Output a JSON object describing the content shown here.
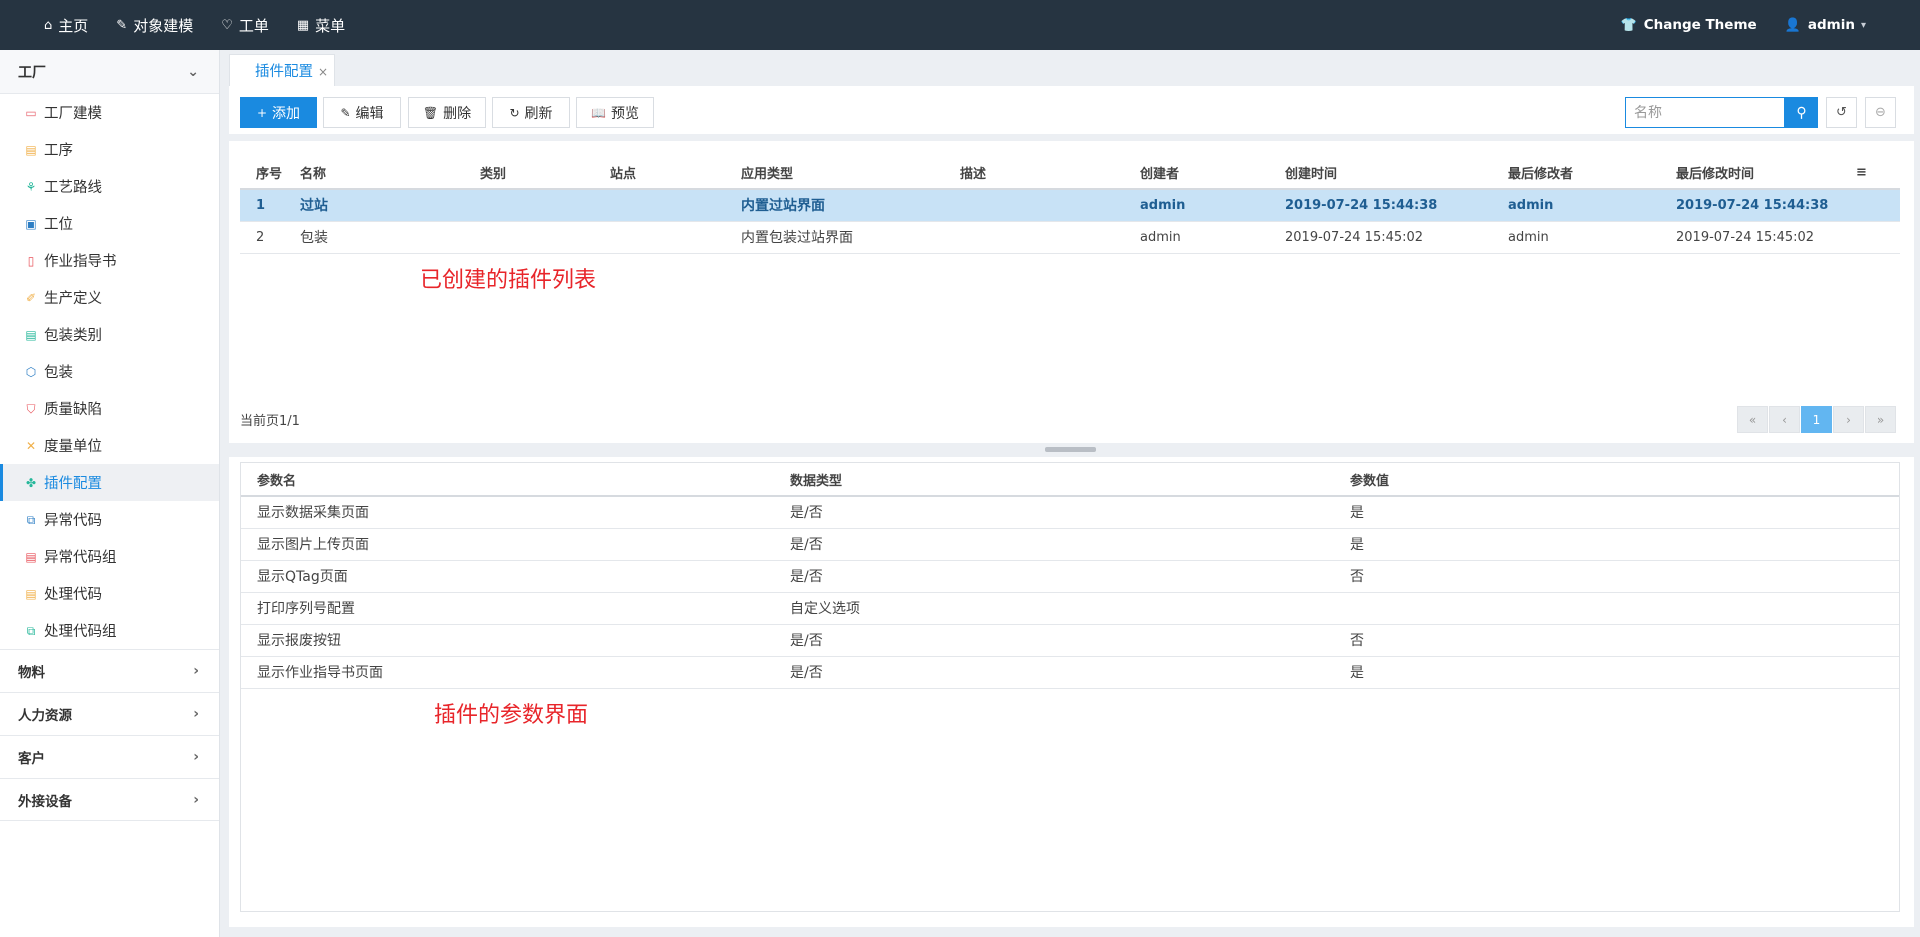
{
  "topnav": [
    {
      "icon": "home-icon",
      "glyph": "⌂",
      "label": "主页"
    },
    {
      "icon": "modeling-icon",
      "glyph": "✎",
      "label": "对象建模"
    },
    {
      "icon": "workorder-icon",
      "glyph": "♡",
      "label": "工单"
    },
    {
      "icon": "menu-grid-icon",
      "glyph": "▦",
      "label": "菜单"
    }
  ],
  "topright": {
    "theme_label": "Change Theme",
    "user_label": "admin"
  },
  "sidebar": {
    "factory_group": "工厂",
    "items": [
      {
        "label": "工厂建模",
        "color": "#e86a74",
        "glyph": "▭"
      },
      {
        "label": "工序",
        "color": "#f0b04a",
        "glyph": "▤"
      },
      {
        "label": "工艺路线",
        "color": "#25b79a",
        "glyph": "⚘"
      },
      {
        "label": "工位",
        "color": "#2d7ec4",
        "glyph": "▣"
      },
      {
        "label": "作业指导书",
        "color": "#e8545c",
        "glyph": "▯"
      },
      {
        "label": "生产定义",
        "color": "#f0b04a",
        "glyph": "✐"
      },
      {
        "label": "包装类别",
        "color": "#25b79a",
        "glyph": "▤"
      },
      {
        "label": "包装",
        "color": "#2d7ec4",
        "glyph": "⬡"
      },
      {
        "label": "质量缺陷",
        "color": "#e8545c",
        "glyph": "⛉"
      },
      {
        "label": "度量单位",
        "color": "#f0b04a",
        "glyph": "✕"
      },
      {
        "label": "插件配置",
        "color": "#25b79a",
        "glyph": "✤"
      },
      {
        "label": "异常代码",
        "color": "#2d7ec4",
        "glyph": "⧉"
      },
      {
        "label": "异常代码组",
        "color": "#e8545c",
        "glyph": "▤"
      },
      {
        "label": "处理代码",
        "color": "#f0b04a",
        "glyph": "▤"
      },
      {
        "label": "处理代码组",
        "color": "#25b79a",
        "glyph": "⧉"
      }
    ],
    "active_index": 10,
    "collapsed_groups": [
      "物料",
      "人力资源",
      "客户",
      "外接设备"
    ]
  },
  "tab": {
    "label": "插件配置",
    "close": "×"
  },
  "toolbar": {
    "add": "添加",
    "edit": "编辑",
    "delete": "删除",
    "refresh": "刷新",
    "preview": "预览",
    "search_placeholder": "名称"
  },
  "upper_table": {
    "columns": [
      "序号",
      "名称",
      "类别",
      "站点",
      "应用类型",
      "描述",
      "创建者",
      "创建时间",
      "最后修改者",
      "最后修改时间"
    ],
    "rows": [
      [
        "1",
        "过站",
        "",
        "",
        "内置过站界面",
        "",
        "admin",
        "2019-07-24 15:44:38",
        "admin",
        "2019-07-24 15:44:38"
      ],
      [
        "2",
        "包装",
        "",
        "",
        "内置包装过站界面",
        "",
        "admin",
        "2019-07-24 15:45:02",
        "admin",
        "2019-07-24 15:45:02"
      ]
    ],
    "selected_row": 0
  },
  "annotations": {
    "upper": "已创建的插件列表",
    "lower": "插件的参数界面"
  },
  "pager": {
    "status": "当前页1/1",
    "first": "«",
    "prev": "‹",
    "current": "1",
    "next": "›",
    "last": "»"
  },
  "lower_table": {
    "columns": [
      "参数名",
      "数据类型",
      "参数值"
    ],
    "rows": [
      [
        "显示数据采集页面",
        "是/否",
        "是"
      ],
      [
        "显示图片上传页面",
        "是/否",
        "是"
      ],
      [
        "显示QTag页面",
        "是/否",
        "否"
      ],
      [
        "打印序列号配置",
        "自定义选项",
        ""
      ],
      [
        "显示报废按钮",
        "是/否",
        "否"
      ],
      [
        "显示作业指导书页面",
        "是/否",
        "是"
      ]
    ]
  },
  "colors": {
    "topbar": "#263441",
    "accent": "#1a8ae0",
    "selected_row": "#c8e2f6",
    "annotation": "#e8252a"
  }
}
